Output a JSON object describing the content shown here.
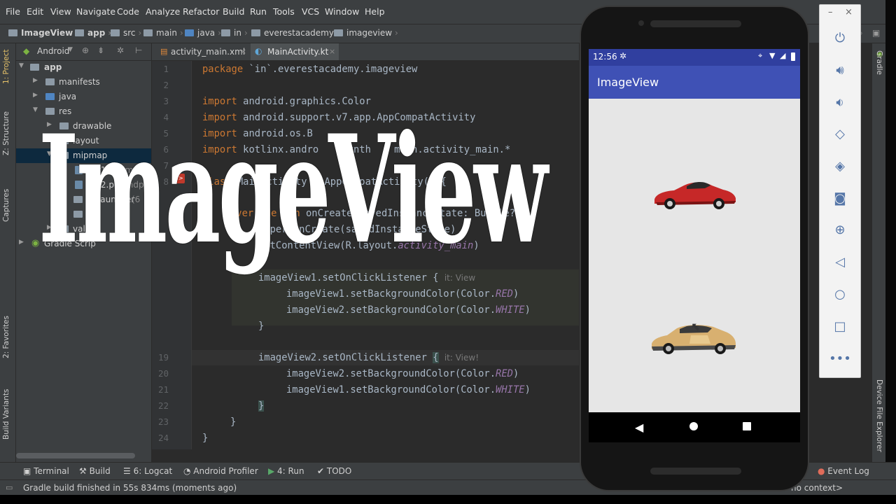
{
  "menu": [
    "File",
    "Edit",
    "View",
    "Navigate",
    "Code",
    "Analyze",
    "Refactor",
    "Build",
    "Run",
    "Tools",
    "VCS",
    "Window",
    "Help"
  ],
  "breadcrumb": [
    "ImageView",
    "app",
    "src",
    "main",
    "java",
    "in",
    "everestacademy",
    "imageview"
  ],
  "left_tool_tabs": {
    "project": "1: Project",
    "structure": "Z: Structure",
    "captures": "Captures",
    "favorites": "2: Favorites",
    "build_variants": "Build Variants"
  },
  "project_panel": {
    "view_selector": "Android",
    "tree": [
      {
        "label": "app"
      },
      {
        "label": "manifests"
      },
      {
        "label": "java"
      },
      {
        "label": "res"
      },
      {
        "label": "drawable"
      },
      {
        "label": "layout"
      },
      {
        "label": "mipmap"
      },
      {
        "label": "car1.png",
        "qualifier": "(mdpi)"
      },
      {
        "label": "car2.png",
        "qualifier": "(mdpi)"
      },
      {
        "label": "ic_launcher",
        "qualifier": "(6"
      },
      {
        "label": "valu"
      },
      {
        "label": "Gradle Scrip"
      }
    ]
  },
  "editor_tabs": [
    {
      "label": "activity_main.xml",
      "active": false
    },
    {
      "label": "MainActivity.kt",
      "active": true
    }
  ],
  "code": {
    "line_numbers": [
      "1",
      "2",
      "3",
      "4",
      "5",
      "6",
      "7",
      "8",
      "",
      "",
      "",
      "",
      "",
      "",
      "",
      "",
      "",
      "",
      "19",
      "20",
      "21",
      "22",
      "23",
      "24"
    ],
    "l1_kw": "package",
    "l1_rest": " `in`.everestacademy.imageview",
    "l3_kw": "import",
    "l3_rest": " android.graphics.Color",
    "l4_kw": "import",
    "l4_rest": " android.support.v7.app.AppCompatActivity",
    "l5_kw": "import",
    "l5_rest": " android.os.B",
    "l6_kw": "import",
    "l6_rest": " kotlinx.andro    synth    main.activity_main.*",
    "l8_kw": "class",
    "l8_rest": " MainActivity : AppCompatActivity() {",
    "l9_kw": "override fun",
    "l9_rest": " onCreate(savedInstanceState: Bundle?)",
    "l10": "super.onCreate(savedInstanceState)",
    "l11_a": "setContentView(R.layout.",
    "l11_b": "activity_main",
    "l13_a": "imageView1.setOnClickListener ",
    "l13_hint": "it: View",
    "l14_a": "imageView1.setBackgroundColor(Color.",
    "l14_b": "RED",
    "l15_a": "imageView2.setBackgroundColor(Color.",
    "l15_b": "WHITE",
    "l16": "}",
    "l19_a": "imageView2.setOnClickListener ",
    "l19_hint": "it: View!",
    "l20_a": "imageView2.setBackgroundColor(Color.",
    "l20_b": "RED",
    "l21_a": "imageView1.setBackgroundColor(Color.",
    "l21_b": "WHITE",
    "l22": "}",
    "l23": "}",
    "l24": "}"
  },
  "overlay_title": "ImageView",
  "bottom_tools": [
    "Terminal",
    "Build",
    "6: Logcat",
    "Android Profiler",
    "4: Run",
    "TODO"
  ],
  "event_log": "Event Log",
  "status": {
    "message": "Gradle build finished in 55s 834ms (moments ago)",
    "context": "no context>"
  },
  "right_tool_tabs": {
    "gradle": "Gradle",
    "device_file_explorer": "Device File Explorer"
  },
  "phone": {
    "time": "12:56",
    "app_title": "ImageView",
    "colors": {
      "app_bar": "#3f51b5",
      "status_bar": "#303f9f",
      "car1": "#c62828",
      "car2": "#d8b070"
    }
  },
  "emulator_controls": [
    "minimize-icon",
    "close-icon",
    "power-icon",
    "volume-up-icon",
    "volume-down-icon",
    "rotate-left-icon",
    "rotate-right-icon",
    "camera-icon",
    "zoom-icon",
    "back-icon",
    "home-icon",
    "overview-icon",
    "more-icon"
  ]
}
